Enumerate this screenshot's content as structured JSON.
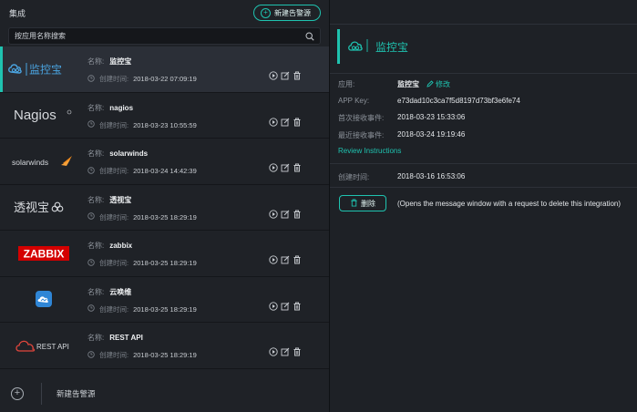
{
  "left": {
    "title": "集成",
    "new_button": "新建告警源",
    "search_placeholder": "按应用名称搜索",
    "items": [
      {
        "logo": "监控宝",
        "name_label": "名称:",
        "name": "监控宝",
        "time_label": "创建时间:",
        "time": "2018-03-22 07:09:19"
      },
      {
        "logo": "Nagios",
        "name_label": "名称:",
        "name": "nagios",
        "time_label": "创建时间:",
        "time": "2018-03-23 10:55:59"
      },
      {
        "logo": "solarwinds",
        "name_label": "名称:",
        "name": "solarwinds",
        "time_label": "创建时间:",
        "time": "2018-03-24 14:42:39"
      },
      {
        "logo": "透视宝",
        "name_label": "名称:",
        "name": "透视宝",
        "time_label": "创建时间:",
        "time": "2018-03-25 18:29:19"
      },
      {
        "logo": "ZABBIX",
        "name_label": "名称:",
        "name": "zabbix",
        "time_label": "创建时间:",
        "time": "2018-03-25 18:29:19"
      },
      {
        "logo": "",
        "name_label": "名称:",
        "name": "云唤维",
        "time_label": "创建时间:",
        "time": "2018-03-25 18:29:19"
      },
      {
        "logo": "REST API",
        "name_label": "名称:",
        "name": "REST API",
        "time_label": "创建时间:",
        "time": "2018-03-25 18:29:19"
      }
    ],
    "footer_label": "新建告警源"
  },
  "right": {
    "brand": "监控宝",
    "app_label": "应用:",
    "app_value": "监控宝",
    "edit_label": "修改",
    "key_label": "APP Key:",
    "key_value": "e73dad10c3ca7f5d8197d73bf3e6fe74",
    "first_label": "首次接收事件:",
    "first_value": "2018-03-23 15:33:06",
    "last_label": "最近接收事件:",
    "last_value": "2018-03-24 19:19:46",
    "review_link": "Review Instructions",
    "created_label": "创建时间:",
    "created_value": "2018-03-16 16:53:06",
    "delete_label": "删除",
    "delete_note": "(Opens the message window with a request to delete this integration)"
  },
  "colors": {
    "accent": "#1fc3b0",
    "zabbix": "#d40000",
    "rest_cloud": "#e0463c",
    "bg": "#1f2227"
  }
}
